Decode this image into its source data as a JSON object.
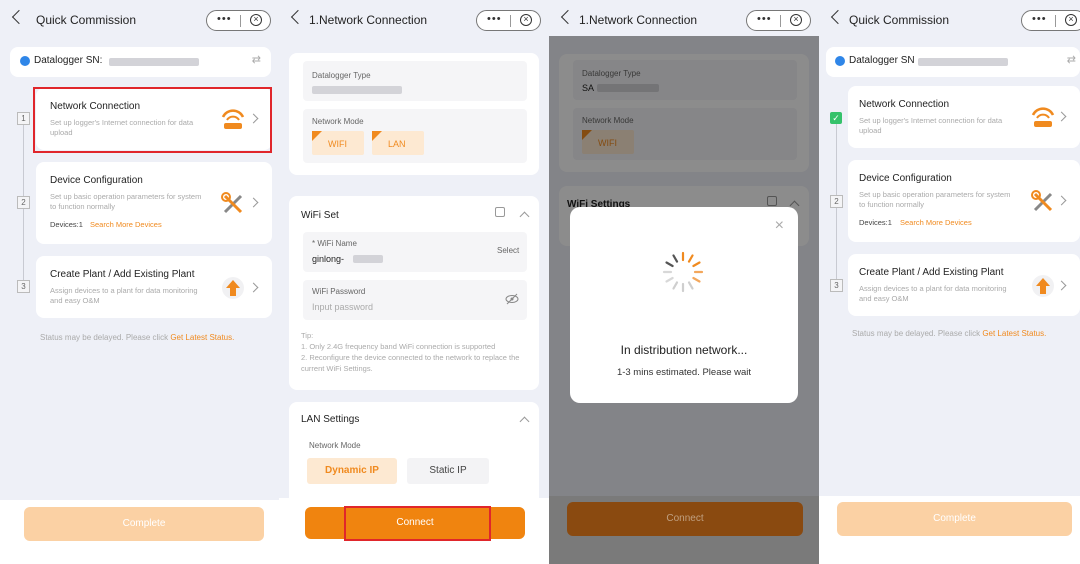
{
  "panel1": {
    "header_title": "Quick Commission",
    "capsule_dots": "•••",
    "capsule_close": "×",
    "sn_label": "Datalogger SN:",
    "steps": [
      {
        "num": "1",
        "title": "Network Connection",
        "desc": "Set up logger's Internet connection for data upload"
      },
      {
        "num": "2",
        "title": "Device Configuration",
        "desc": "Set up basic operation parameters for system to function normally",
        "devices": "Devices:1",
        "search": "Search More Devices"
      },
      {
        "num": "3",
        "title": "Create Plant / Add Existing Plant",
        "desc": "Assign devices to a plant for data monitoring and easy O&M"
      }
    ],
    "status_text": "Status may be delayed. Please click",
    "status_link": "Get Latest Status.",
    "complete_label": "Complete"
  },
  "panel2": {
    "header_title": "1.Network Connection",
    "datalogger_type_label": "Datalogger Type",
    "network_mode_label": "Network Mode",
    "modes": [
      "WIFI",
      "LAN"
    ],
    "wifi_set_title": "WiFi Set",
    "wifi_name_label": "* WiFi Name",
    "wifi_name_value": "ginlong-",
    "select_label": "Select",
    "wifi_password_label": "WiFi Password",
    "wifi_password_placeholder": "Input password",
    "tip_title": "Tip:",
    "tip_1": "1. Only 2.4G frequency band WiFi connection is supported",
    "tip_2": "2. Reconfigure the device connected to the network to replace the current WiFi Settings.",
    "lan_title": "LAN Settings",
    "lan_mode_label": "Network Mode",
    "dynamic_ip": "Dynamic IP",
    "static_ip": "Static IP",
    "connect_label": "Connect"
  },
  "panel3": {
    "header_title": "1.Network Connection",
    "datalogger_type_label": "Datalogger Type",
    "datalogger_type_value": "SA",
    "network_mode_label": "Network Mode",
    "mode": "WIFI",
    "wifi_settings_title": "WiFi Settings",
    "modal_title": "In distribution network...",
    "modal_sub": "1-3 mins estimated. Please wait",
    "connect_label": "Connect"
  },
  "panel4": {
    "header_title": "Quick Commission",
    "sn_label": "Datalogger SN",
    "steps": [
      {
        "num": "✓",
        "title": "Network Connection",
        "desc": "Set up logger's Internet connection for data upload"
      },
      {
        "num": "2",
        "title": "Device Configuration",
        "desc": "Set up basic operation parameters for system to function normally",
        "devices": "Devices:1",
        "search": "Search More Devices"
      },
      {
        "num": "3",
        "title": "Create Plant / Add Existing Plant",
        "desc": "Assign devices to a plant for data monitoring and easy O&M"
      }
    ],
    "status_text": "Status may be delayed. Please click",
    "status_link": "Get Latest Status.",
    "complete_label": "Complete"
  },
  "colors": {
    "accent": "#f08a1f",
    "highlight_box": "#e0262b",
    "success": "#35c26b",
    "info": "#2f86e8"
  }
}
